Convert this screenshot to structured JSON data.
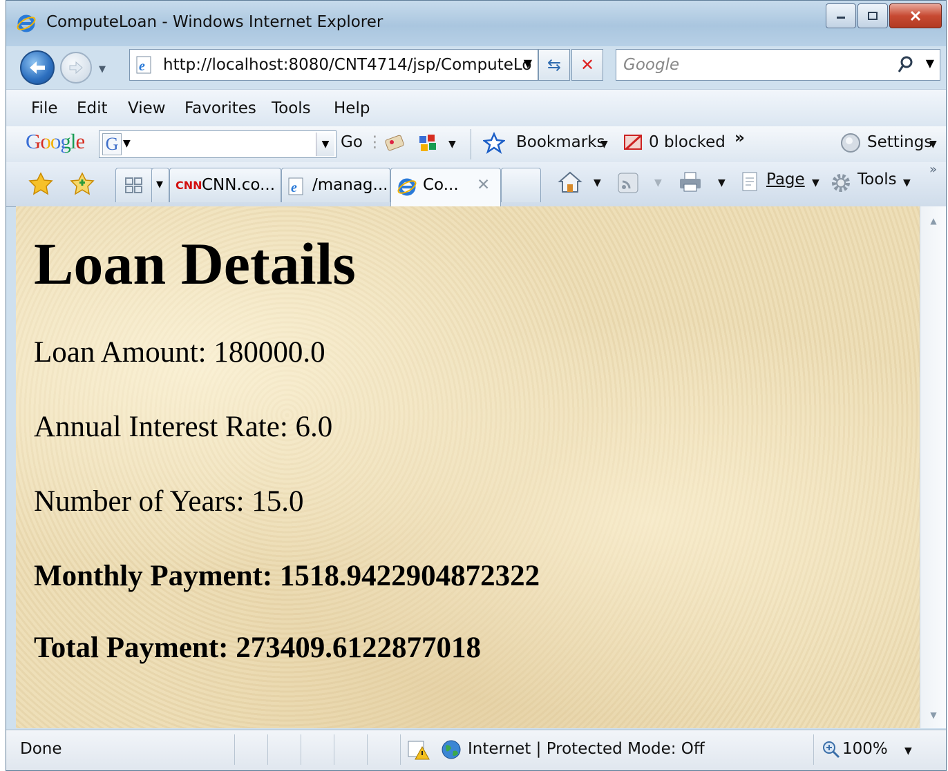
{
  "window": {
    "title": "ComputeLoan - Windows Internet Explorer"
  },
  "address_bar": {
    "url": "http://localhost:8080/CNT4714/jsp/ComputeLo"
  },
  "search": {
    "placeholder": "Google"
  },
  "menu": [
    "File",
    "Edit",
    "View",
    "Favorites",
    "Tools",
    "Help"
  ],
  "google_toolbar": {
    "logo": "Google",
    "search_letter": "G",
    "go_label": "Go",
    "bookmarks_label": "Bookmarks",
    "blocked_label": "0 blocked",
    "more_label": "»",
    "settings_label": "Settings"
  },
  "tabs": [
    {
      "label": "CNN.co...",
      "icon": "cnn-icon"
    },
    {
      "label": "/manag...",
      "icon": "ie-page-icon"
    },
    {
      "label": "Co...",
      "icon": "ie-icon",
      "active": true
    }
  ],
  "command_bar": {
    "page_label": "Page",
    "tools_label": "Tools",
    "overflow": "»"
  },
  "page": {
    "heading": "Loan Details",
    "loan_amount": "Loan Amount: 180000.0",
    "interest_rate": "Annual Interest Rate: 6.0",
    "years": "Number of Years: 15.0",
    "monthly_payment": "Monthly Payment: 1518.9422904872322",
    "total_payment": "Total Payment: 273409.6122877018"
  },
  "status_bar": {
    "status": "Done",
    "zone": "Internet | Protected Mode: Off",
    "zoom": "100%"
  },
  "colors": {
    "titlebar": "#b7d0e6",
    "page_background": "#ecdcb4",
    "close_button": "#c74a33"
  }
}
